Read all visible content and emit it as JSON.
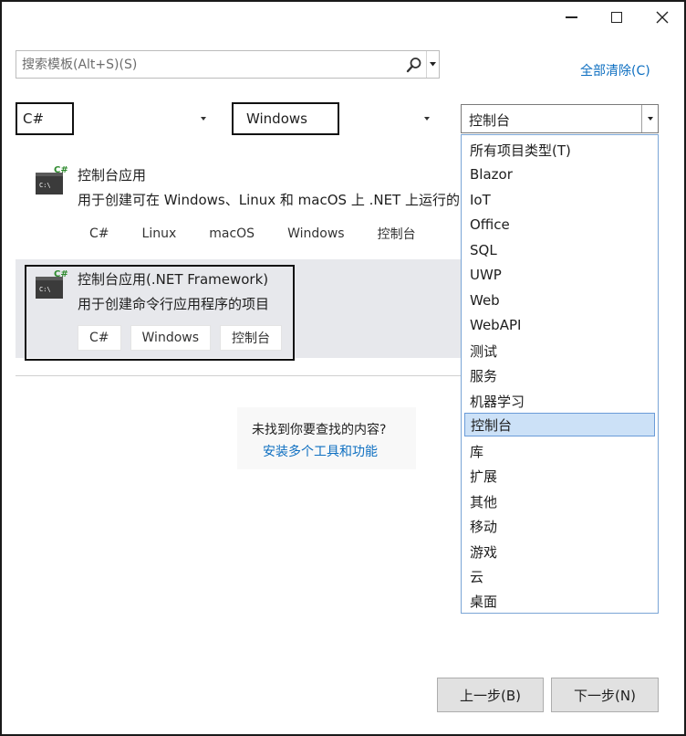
{
  "window": {
    "minimize_icon": "minimize-icon",
    "maximize_icon": "maximize-icon",
    "close_icon": "close-icon"
  },
  "search": {
    "placeholder": "搜索模板(Alt+S)(S)",
    "icon": "search-icon"
  },
  "clear_all": "全部清除(C)",
  "filters": {
    "language": "C#",
    "platform": "Windows",
    "project_type": "控制台"
  },
  "templates": [
    {
      "name": "控制台应用",
      "description": "用于创建可在 Windows、Linux 和 macOS 上 .NET 上运行的",
      "tags": [
        "C#",
        "Linux",
        "macOS",
        "Windows",
        "控制台"
      ]
    },
    {
      "name": "控制台应用(.NET Framework)",
      "description": "用于创建命令行应用程序的项目",
      "tags": [
        "C#",
        "Windows",
        "控制台"
      ]
    }
  ],
  "not_found": {
    "question": "未找到你要查找的内容?",
    "link": "安装多个工具和功能"
  },
  "project_type_options": [
    "所有项目类型(T)",
    "Blazor",
    "IoT",
    "Office",
    "SQL",
    "UWP",
    "Web",
    "WebAPI",
    "测试",
    "服务",
    "机器学习",
    "控制台",
    "库",
    "扩展",
    "其他",
    "移动",
    "游戏",
    "云",
    "桌面"
  ],
  "selected_option": "控制台",
  "buttons": {
    "back": "上一步(B)",
    "next": "下一步(N)"
  },
  "colors": {
    "link": "#0e6fc1",
    "selection": "#cce1f7",
    "highlight_row": "#e7e8ec",
    "icon_green": "#2d8a2d"
  }
}
